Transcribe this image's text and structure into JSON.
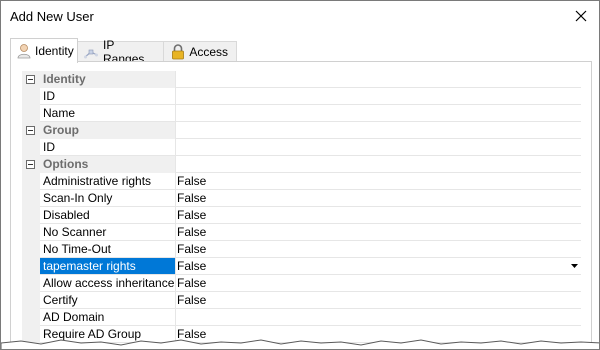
{
  "window": {
    "title": "Add New User"
  },
  "tabs": [
    {
      "label": "Identity",
      "icon": "user-icon",
      "active": true
    },
    {
      "label": "IP Ranges",
      "icon": "network-icon",
      "active": false
    },
    {
      "label": "Access",
      "icon": "lock-icon",
      "active": false
    }
  ],
  "grid": {
    "rows": [
      {
        "type": "category",
        "name": "Identity"
      },
      {
        "type": "property",
        "name": "ID",
        "value": ""
      },
      {
        "type": "property",
        "name": "Name",
        "value": ""
      },
      {
        "type": "category",
        "name": "Group"
      },
      {
        "type": "property",
        "name": "ID",
        "value": ""
      },
      {
        "type": "category",
        "name": "Options"
      },
      {
        "type": "property",
        "name": "Administrative rights",
        "value": "False"
      },
      {
        "type": "property",
        "name": "Scan-In Only",
        "value": "False"
      },
      {
        "type": "property",
        "name": "Disabled",
        "value": "False"
      },
      {
        "type": "property",
        "name": "No Scanner",
        "value": "False"
      },
      {
        "type": "property",
        "name": "No Time-Out",
        "value": "False"
      },
      {
        "type": "property",
        "name": "tapemaster rights",
        "value": "False",
        "selected": true
      },
      {
        "type": "property",
        "name": "Allow access inheritance",
        "value": "False"
      },
      {
        "type": "property",
        "name": "Certify",
        "value": "False"
      },
      {
        "type": "property",
        "name": "AD Domain",
        "value": ""
      },
      {
        "type": "property",
        "name": "Require AD Group",
        "value": "False"
      }
    ]
  },
  "colors": {
    "selection": "#0078d7",
    "category_bg": "#f0f0f0",
    "category_text": "#6d6d6d"
  }
}
